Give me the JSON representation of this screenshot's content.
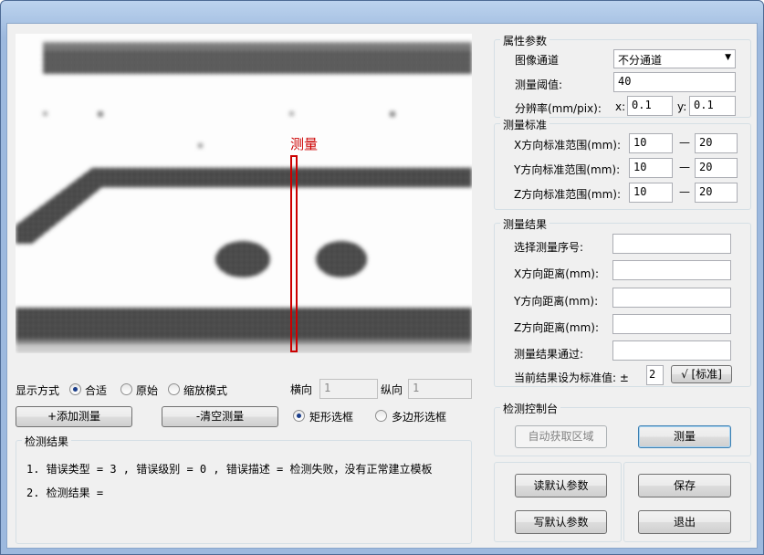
{
  "canvas": {
    "overlay_label": "测量"
  },
  "display": {
    "mode_label": "显示方式",
    "options": [
      "合适",
      "原始",
      "缩放模式"
    ],
    "h_label": "横向",
    "h_value": "1",
    "v_label": "纵向",
    "v_value": "1"
  },
  "buttons": {
    "add_measure": "+添加测量",
    "clear_measure": "-清空测量",
    "read_default": "读默认参数",
    "write_default": "写默认参数",
    "save": "保存",
    "exit": "退出",
    "auto_region": "自动获取区域",
    "measure": "测量",
    "set_standard": "√ [标准]"
  },
  "selection": {
    "rect": "矩形选框",
    "polygon": "多边形选框"
  },
  "result_box": {
    "title": "检测结果",
    "line1": "1. 错误类型 = 3 , 错误级别 = 0 , 错误描述 = 检测失败，没有正常建立模板",
    "line2": "2. 检测结果 ="
  },
  "attributes": {
    "title": "属性参数",
    "channel_label": "图像通道",
    "channel_value": "不分通道",
    "threshold_label": "测量阈值:",
    "threshold_value": "40",
    "resolution_label": "分辨率(mm/pix):",
    "x_label": "x:",
    "x_value": "0.1",
    "y_label": "y:",
    "y_value": "0.1"
  },
  "standard": {
    "title": "测量标准",
    "rows": [
      {
        "label": "X方向标准范围(mm):",
        "min": "10",
        "max": "20"
      },
      {
        "label": "Y方向标准范围(mm):",
        "min": "10",
        "max": "20"
      },
      {
        "label": "Z方向标准范围(mm):",
        "min": "10",
        "max": "20"
      }
    ],
    "dash": "—"
  },
  "results": {
    "title": "测量结果",
    "rows": [
      "选择测量序号:",
      "X方向距离(mm):",
      "Y方向距离(mm):",
      "Z方向距离(mm):",
      "测量结果通过:"
    ],
    "set_std_label": "当前结果设为标准值: ±",
    "set_std_value": "2"
  },
  "control": {
    "title": "检测控制台"
  }
}
